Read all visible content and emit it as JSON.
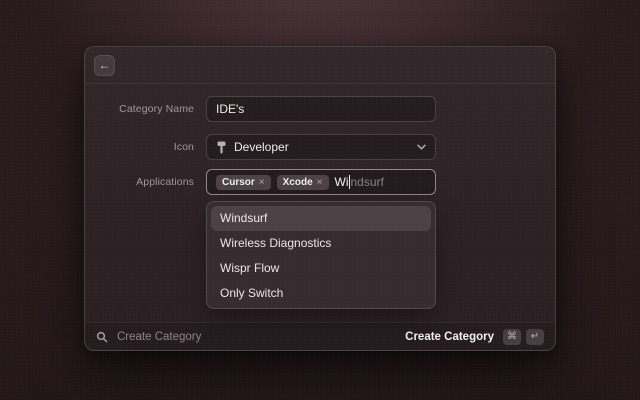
{
  "window": {
    "back_glyph": "←"
  },
  "form": {
    "category_name": {
      "label": "Category Name",
      "value": "IDE's"
    },
    "icon": {
      "label": "Icon",
      "value": "Developer",
      "icon_name": "hammer-icon"
    },
    "applications": {
      "label": "Applications",
      "tags": [
        "Cursor",
        "Xcode"
      ],
      "tag_remove_glyph": "×",
      "typed": "Wi",
      "completion": "ndsurf"
    }
  },
  "dropdown": {
    "items": [
      {
        "label": "Windsurf",
        "selected": true
      },
      {
        "label": "Wireless Diagnostics",
        "selected": false
      },
      {
        "label": "Wispr Flow",
        "selected": false
      },
      {
        "label": "Only Switch",
        "selected": false
      }
    ]
  },
  "footer": {
    "placeholder": "Create Category",
    "action_label": "Create Category",
    "shortcut_keys": [
      "⌘",
      "↵"
    ]
  },
  "colors": {
    "background": "#211617",
    "panel": "#2c2225",
    "dropdown": "#362c2f",
    "highlight_row": "#4c4245",
    "tag": "#4d4346",
    "text_primary": "#f0ebec",
    "text_muted": "#a2969a"
  }
}
